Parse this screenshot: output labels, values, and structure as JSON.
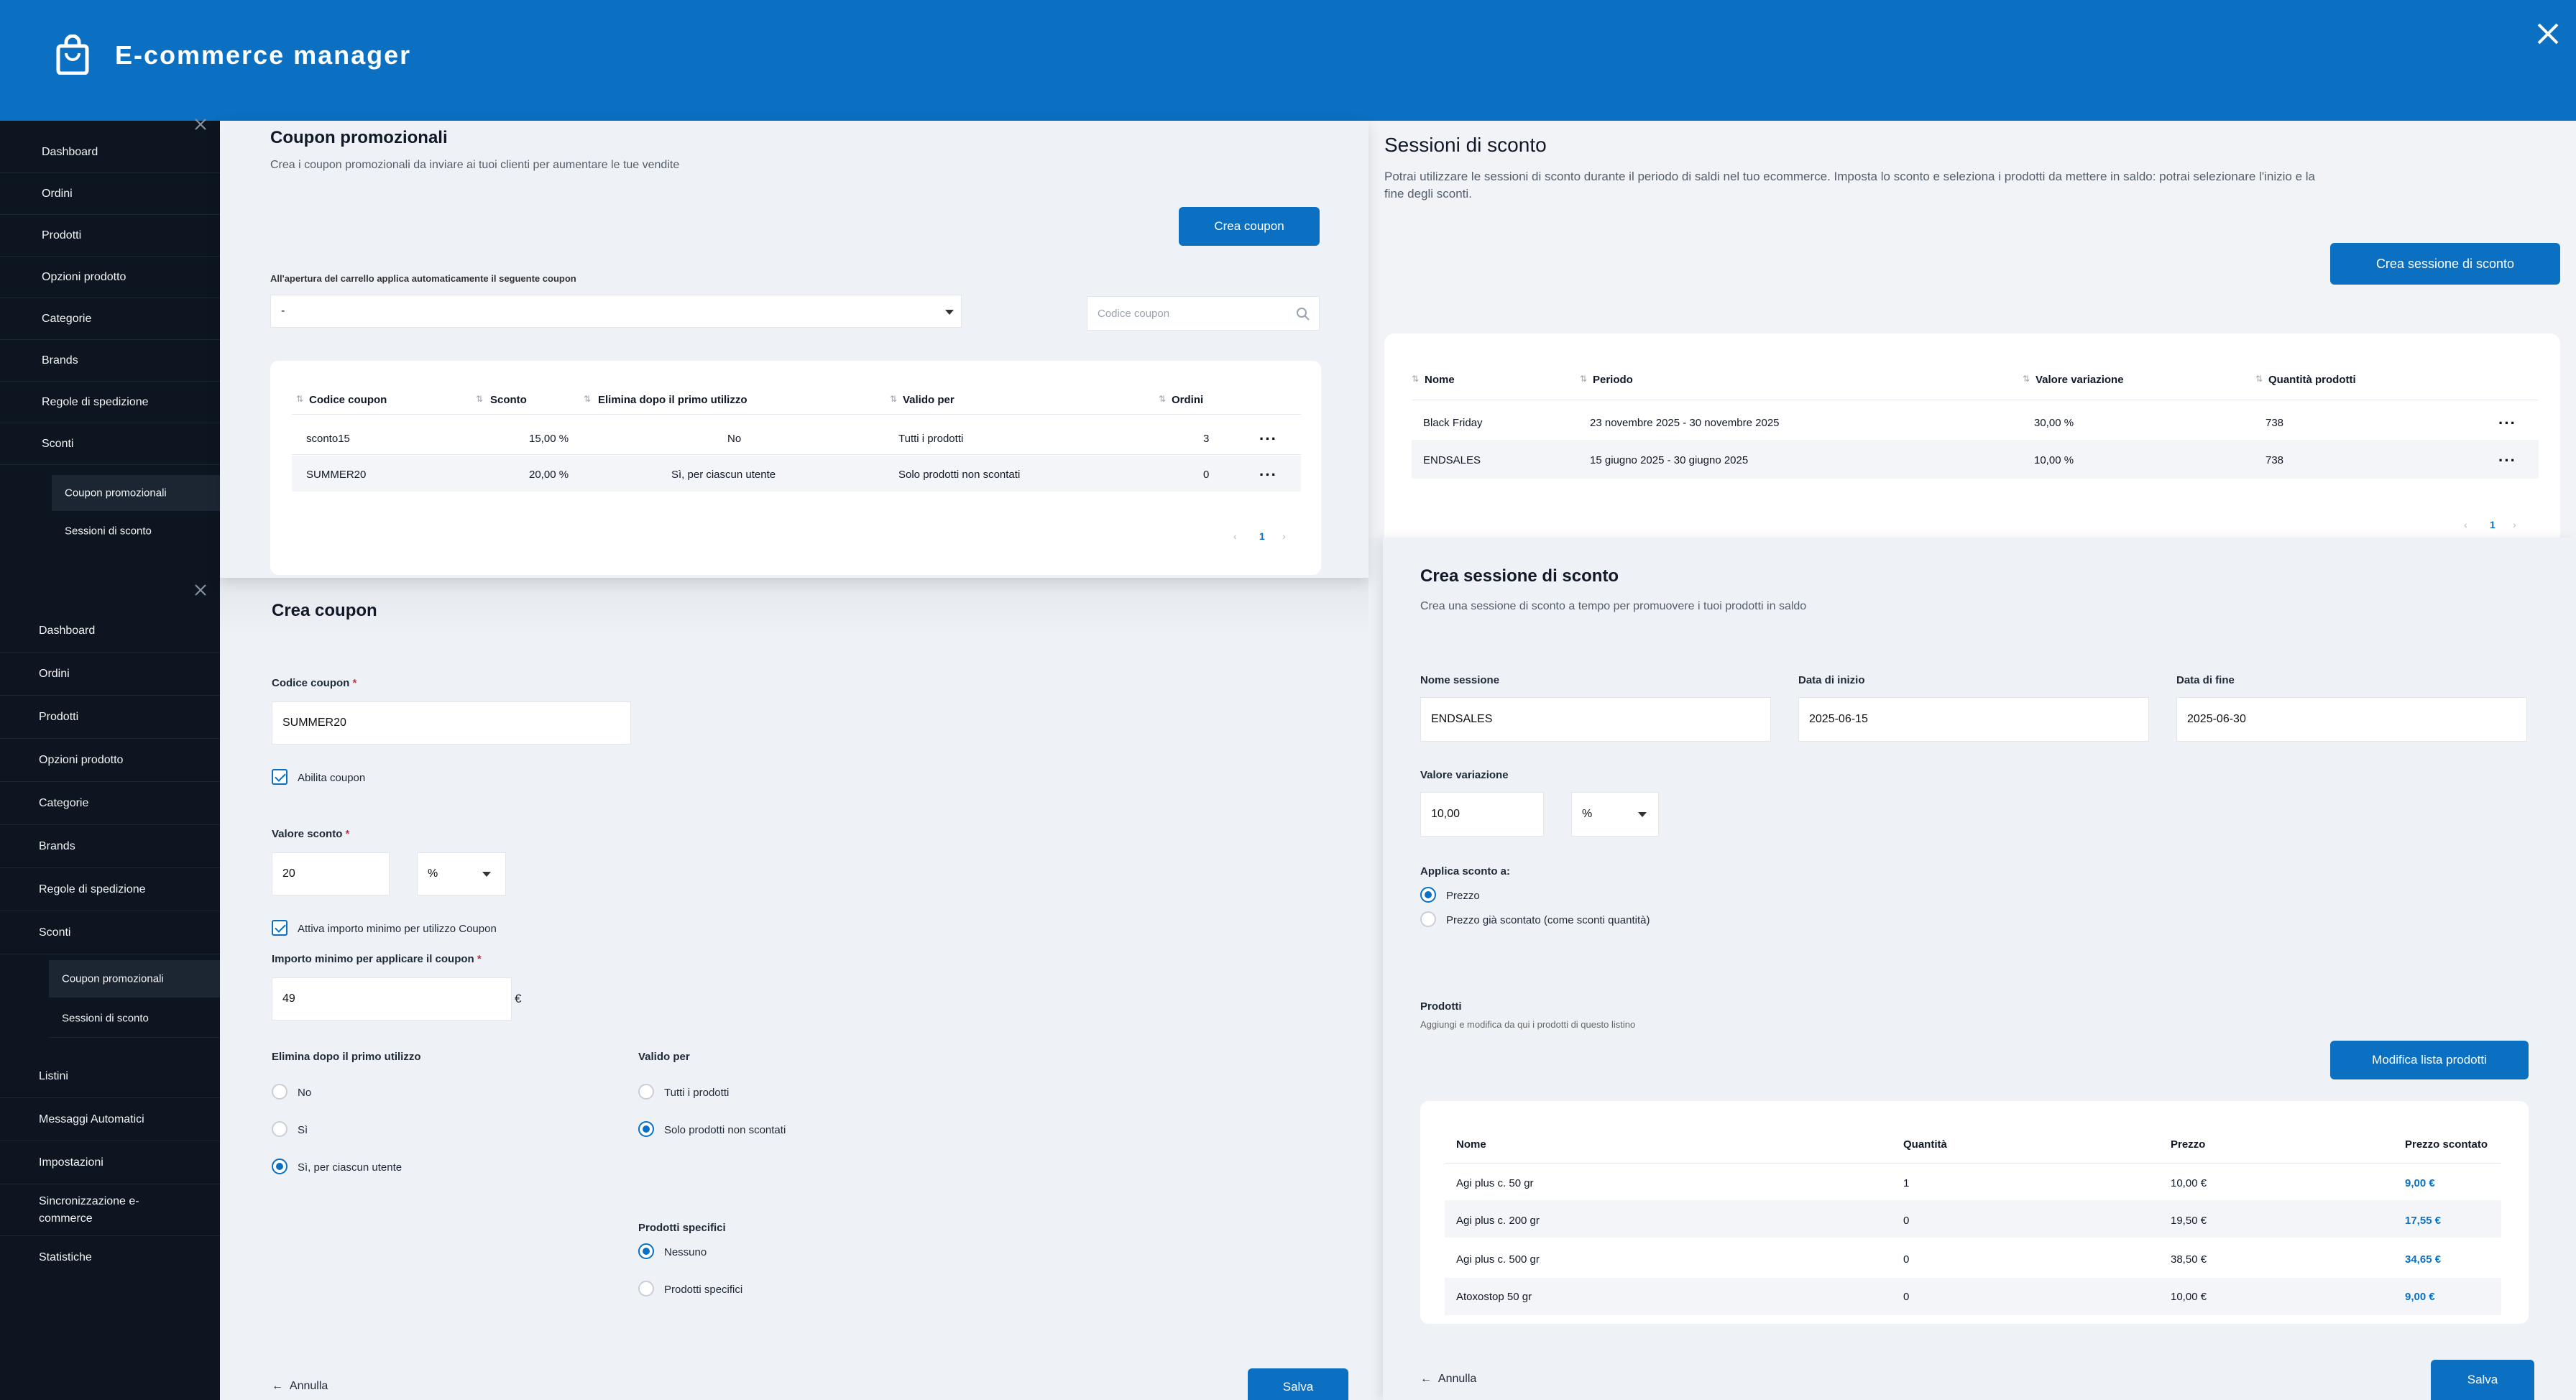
{
  "app": {
    "title": "E-commerce manager"
  },
  "sidebar_top": {
    "items": [
      "Dashboard",
      "Ordini",
      "Prodotti",
      "Opzioni prodotto",
      "Categorie",
      "Brands",
      "Regole di spedizione",
      "Sconti"
    ],
    "subitems": [
      "Coupon promozionali",
      "Sessioni di sconto"
    ]
  },
  "sidebar_bottom": {
    "items": [
      "Dashboard",
      "Ordini",
      "Prodotti",
      "Opzioni prodotto",
      "Categorie",
      "Brands",
      "Regole di spedizione",
      "Sconti"
    ],
    "subitems": [
      "Coupon promozionali",
      "Sessioni di sconto"
    ],
    "items_after": [
      "Listini",
      "Messaggi Automatici",
      "Impostazioni",
      "Sincronizzazione e-commerce",
      "Statistiche"
    ]
  },
  "coupon_list": {
    "title": "Coupon promozionali",
    "description": "Crea i coupon promozionali da inviare ai tuoi clienti per aumentare le tue vendite",
    "create_button": "Crea coupon",
    "auto_apply_label": "All'apertura del carrello applica automaticamente il seguente coupon",
    "auto_apply_value": "-",
    "search_placeholder": "Codice coupon",
    "columns": [
      "Codice coupon",
      "Sconto",
      "Elimina dopo il primo utilizzo",
      "Valido per",
      "Ordini"
    ],
    "rows": [
      {
        "code": "sconto15",
        "discount": "15,00 %",
        "delete_after": "No",
        "valid_for": "Tutti i prodotti",
        "orders": "3"
      },
      {
        "code": "SUMMER20",
        "discount": "20,00 %",
        "delete_after": "Sì, per ciascun utente",
        "valid_for": "Solo prodotti non scontati",
        "orders": "0"
      }
    ],
    "page": "1"
  },
  "create_coupon": {
    "title": "Crea coupon",
    "code_label": "Codice coupon",
    "required_mark": "*",
    "code_value": "SUMMER20",
    "enable_label": "Abilita coupon",
    "discount_label": "Valore sconto",
    "discount_value": "20",
    "discount_unit": "%",
    "min_amount_check": "Attiva importo minimo per utilizzo Coupon",
    "min_amount_label": "Importo minimo per applicare il coupon",
    "min_amount_value": "49",
    "currency": "€",
    "delete_after_label": "Elimina dopo il primo utilizzo",
    "delete_after_options": [
      "No",
      "Sì",
      "Sì, per ciascun utente"
    ],
    "delete_after_selected": 2,
    "valid_for_label": "Valido per",
    "valid_for_options": [
      "Tutti i prodotti",
      "Solo prodotti non scontati"
    ],
    "valid_for_selected": 1,
    "specific_label": "Prodotti specifici",
    "specific_options": [
      "Nessuno",
      "Prodotti specifici"
    ],
    "specific_selected": 0,
    "cancel": "Annulla",
    "save": "Salva"
  },
  "sessions": {
    "title": "Sessioni di sconto",
    "description": "Potrai utilizzare le sessioni di sconto durante il periodo di saldi nel tuo ecommerce. Imposta lo sconto e seleziona i prodotti da mettere in saldo: potrai selezionare l'inizio e la fine degli sconti.",
    "create_button": "Crea sessione di sconto",
    "columns": [
      "Nome",
      "Periodo",
      "Valore variazione",
      "Quantità prodotti"
    ],
    "rows": [
      {
        "name": "Black Friday",
        "period": "23 novembre 2025 - 30 novembre 2025",
        "value": "30,00 %",
        "qty": "738"
      },
      {
        "name": "ENDSALES",
        "period": "15 giugno 2025 - 30 giugno 2025",
        "value": "10,00 %",
        "qty": "738"
      }
    ],
    "page": "1"
  },
  "create_session": {
    "title": "Crea sessione di sconto",
    "description": "Crea una sessione di sconto a tempo per promuovere i tuoi prodotti in saldo",
    "name_label": "Nome sessione",
    "name_value": "ENDSALES",
    "start_label": "Data di inizio",
    "start_value": "2025-06-15",
    "end_label": "Data di fine",
    "end_value": "2025-06-30",
    "variation_label": "Valore variazione",
    "variation_value": "10,00",
    "variation_unit": "%",
    "apply_label": "Applica sconto a:",
    "apply_options": [
      "Prezzo",
      "Prezzo già scontato (come sconti quantità)"
    ],
    "apply_selected": 0,
    "products_label": "Prodotti",
    "products_desc": "Aggiungi e modifica da qui i prodotti di questo listino",
    "edit_products_button": "Modifica lista prodotti",
    "columns": [
      "Nome",
      "Quantità",
      "Prezzo",
      "Prezzo scontato"
    ],
    "rows": [
      {
        "name": "Agi plus c. 50 gr",
        "qty": "1",
        "price": "10,00 €",
        "discounted": "9,00 €"
      },
      {
        "name": "Agi plus c. 200 gr",
        "qty": "0",
        "price": "19,50 €",
        "discounted": "17,55 €"
      },
      {
        "name": "Agi plus c. 500 gr",
        "qty": "0",
        "price": "38,50 €",
        "discounted": "34,65 €"
      },
      {
        "name": "Atoxostop 50 gr",
        "qty": "0",
        "price": "10,00 €",
        "discounted": "9,00 €"
      }
    ],
    "cancel": "Annulla",
    "save": "Salva"
  },
  "colors": {
    "brand": "#0b6fc2",
    "sidebar": "#0d1520",
    "background": "#eef1f6"
  }
}
